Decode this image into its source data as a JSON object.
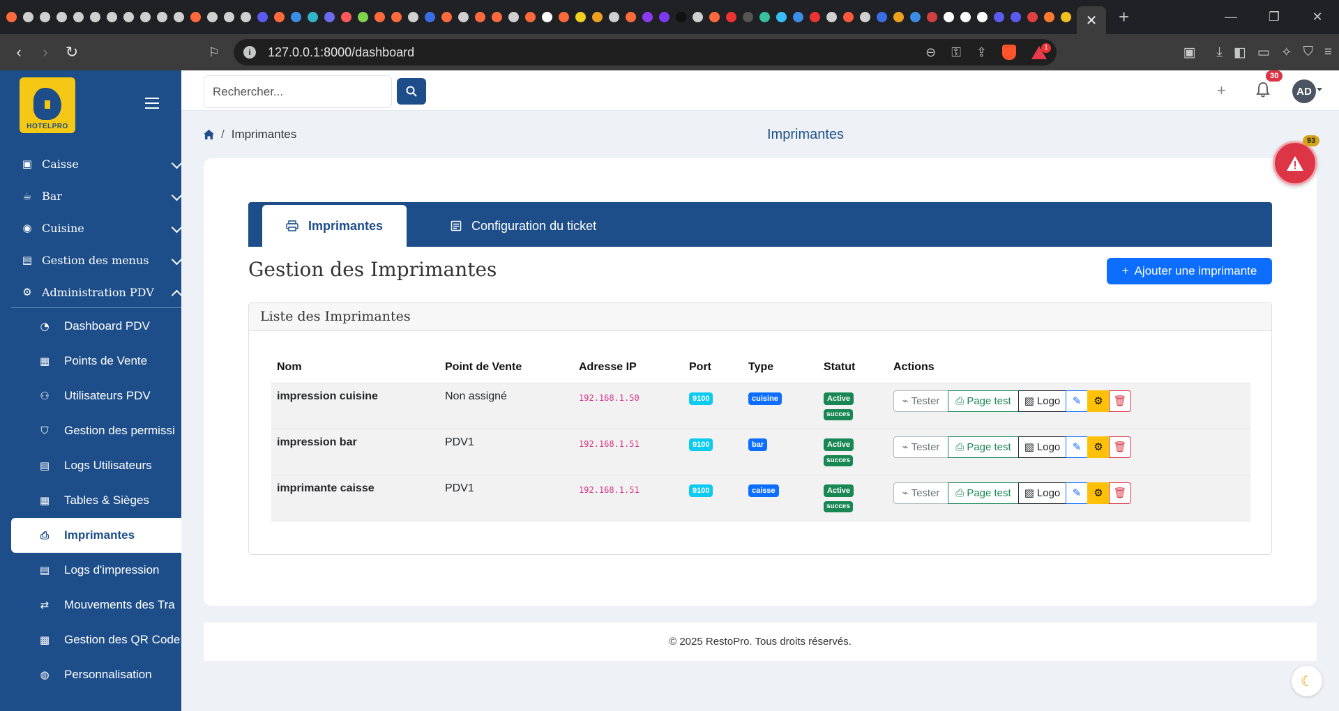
{
  "browser": {
    "url": "127.0.0.1:8000/dashboard",
    "menu_badge": "1",
    "favicon_colors": [
      "#ff6a3d",
      "#d0d0d0",
      "#d0d0d0",
      "#d0d0d0",
      "#d0d0d0",
      "#d0d0d0",
      "#d0d0d0",
      "#d0d0d0",
      "#d0d0d0",
      "#d0d0d0",
      "#d0d0d0",
      "#ff6a3d",
      "#d0d0d0",
      "#d0d0d0",
      "#d0d0d0",
      "#5b5bf0",
      "#ff6a3d",
      "#3a8ee6",
      "#34b4c8",
      "#6b6bf0",
      "#ff5a5a",
      "#7fd34c",
      "#ff6a3d",
      "#ff6a3d",
      "#d0d0d0",
      "#3a6ee6",
      "#ff6a3d",
      "#d0d0d0",
      "#ff6a3d",
      "#ff6a3d",
      "#d0d0d0",
      "#ff6a3d",
      "#ffffff",
      "#ff6a3d",
      "#f0d020",
      "#f0a020",
      "#d0d0d0",
      "#ff6a3d",
      "#8a3af0",
      "#7b3af0",
      "#111111",
      "#d0d0d0",
      "#ff6a3d",
      "#e33",
      "#555",
      "#3ac0a0",
      "#38bdf8",
      "#3a8ee6",
      "#e33",
      "#d0d0d0",
      "#ff5a3d",
      "#d0d0d0",
      "#3a6ee6",
      "#f0a020",
      "#3a8ee6",
      "#d04040",
      "#ffffff",
      "#ffffff",
      "#ffffff",
      "#5b5bf0",
      "#5b5bf0",
      "#e04040",
      "#ff7a30",
      "#f0c020"
    ]
  },
  "sidebar": {
    "logo_text": "HOTELPRO",
    "groups": [
      {
        "label": "Caisse",
        "icon": "cash-register-icon",
        "glyph": "▣"
      },
      {
        "label": "Bar",
        "icon": "cup-icon",
        "glyph": "☕"
      },
      {
        "label": "Cuisine",
        "icon": "cookie-icon",
        "glyph": "◉"
      },
      {
        "label": "Gestion des menus",
        "icon": "menu-book-icon",
        "glyph": "▤"
      },
      {
        "label": "Administration PDV",
        "icon": "gear-icon",
        "glyph": "⚙"
      }
    ],
    "items": [
      {
        "label": "Dashboard PDV",
        "icon": "gauge-icon",
        "glyph": "◔"
      },
      {
        "label": "Points de Vente",
        "icon": "building-icon",
        "glyph": "▦"
      },
      {
        "label": "Utilisateurs PDV",
        "icon": "users-icon",
        "glyph": "⚇"
      },
      {
        "label": "Gestion des permissi",
        "icon": "shield-icon",
        "glyph": "⛉"
      },
      {
        "label": "Logs Utilisateurs",
        "icon": "document-icon",
        "glyph": "▤"
      },
      {
        "label": "Tables & Sièges",
        "icon": "table-icon",
        "glyph": "▦"
      },
      {
        "label": "Imprimantes",
        "icon": "printer-icon",
        "glyph": "⎙"
      },
      {
        "label": "Logs d'impression",
        "icon": "file-icon",
        "glyph": "▤"
      },
      {
        "label": "Mouvements des Tra",
        "icon": "shuffle-icon",
        "glyph": "⇄"
      },
      {
        "label": "Gestion des QR Code",
        "icon": "qr-code-icon",
        "glyph": "▩"
      },
      {
        "label": "Personnalisation",
        "icon": "palette-icon",
        "glyph": "◍"
      }
    ]
  },
  "topbar": {
    "search_placeholder": "Rechercher...",
    "notif_count": "30",
    "avatar": "AD"
  },
  "breadcrumb": {
    "current": "Imprimantes"
  },
  "page_title": "Imprimantes",
  "tabs": {
    "printers": "Imprimantes",
    "ticket_config": "Configuration du ticket"
  },
  "section_title": "Gestion des Imprimantes",
  "add_button": "Ajouter une imprimante",
  "list_title": "Liste des Imprimantes",
  "table": {
    "headers": [
      "Nom",
      "Point de Vente",
      "Adresse IP",
      "Port",
      "Type",
      "Statut",
      "Actions"
    ],
    "rows": [
      {
        "name": "impression cuisine",
        "pdv": "Non assigné",
        "ip": "192.168.1.50",
        "port": "9100",
        "type": "cuisine",
        "status": "Active",
        "result": "succes"
      },
      {
        "name": "impression bar",
        "pdv": "PDV1",
        "ip": "192.168.1.51",
        "port": "9100",
        "type": "bar",
        "status": "Active",
        "result": "succes"
      },
      {
        "name": "imprimante caisse",
        "pdv": "PDV1",
        "ip": "192.168.1.51",
        "port": "9100",
        "type": "caisse",
        "status": "Active",
        "result": "succes"
      }
    ],
    "actions": {
      "test": "Tester",
      "page_test": "Page test",
      "logo": "Logo"
    }
  },
  "footer": "© 2025 RestoPro. Tous droits réservés.",
  "alerts_count": "93",
  "colors": {
    "primary": "#1d4e89",
    "accent": "#0d6efd",
    "success": "#198754",
    "danger": "#dc3545",
    "warning": "#ffc107",
    "info": "#0dcaf0"
  }
}
